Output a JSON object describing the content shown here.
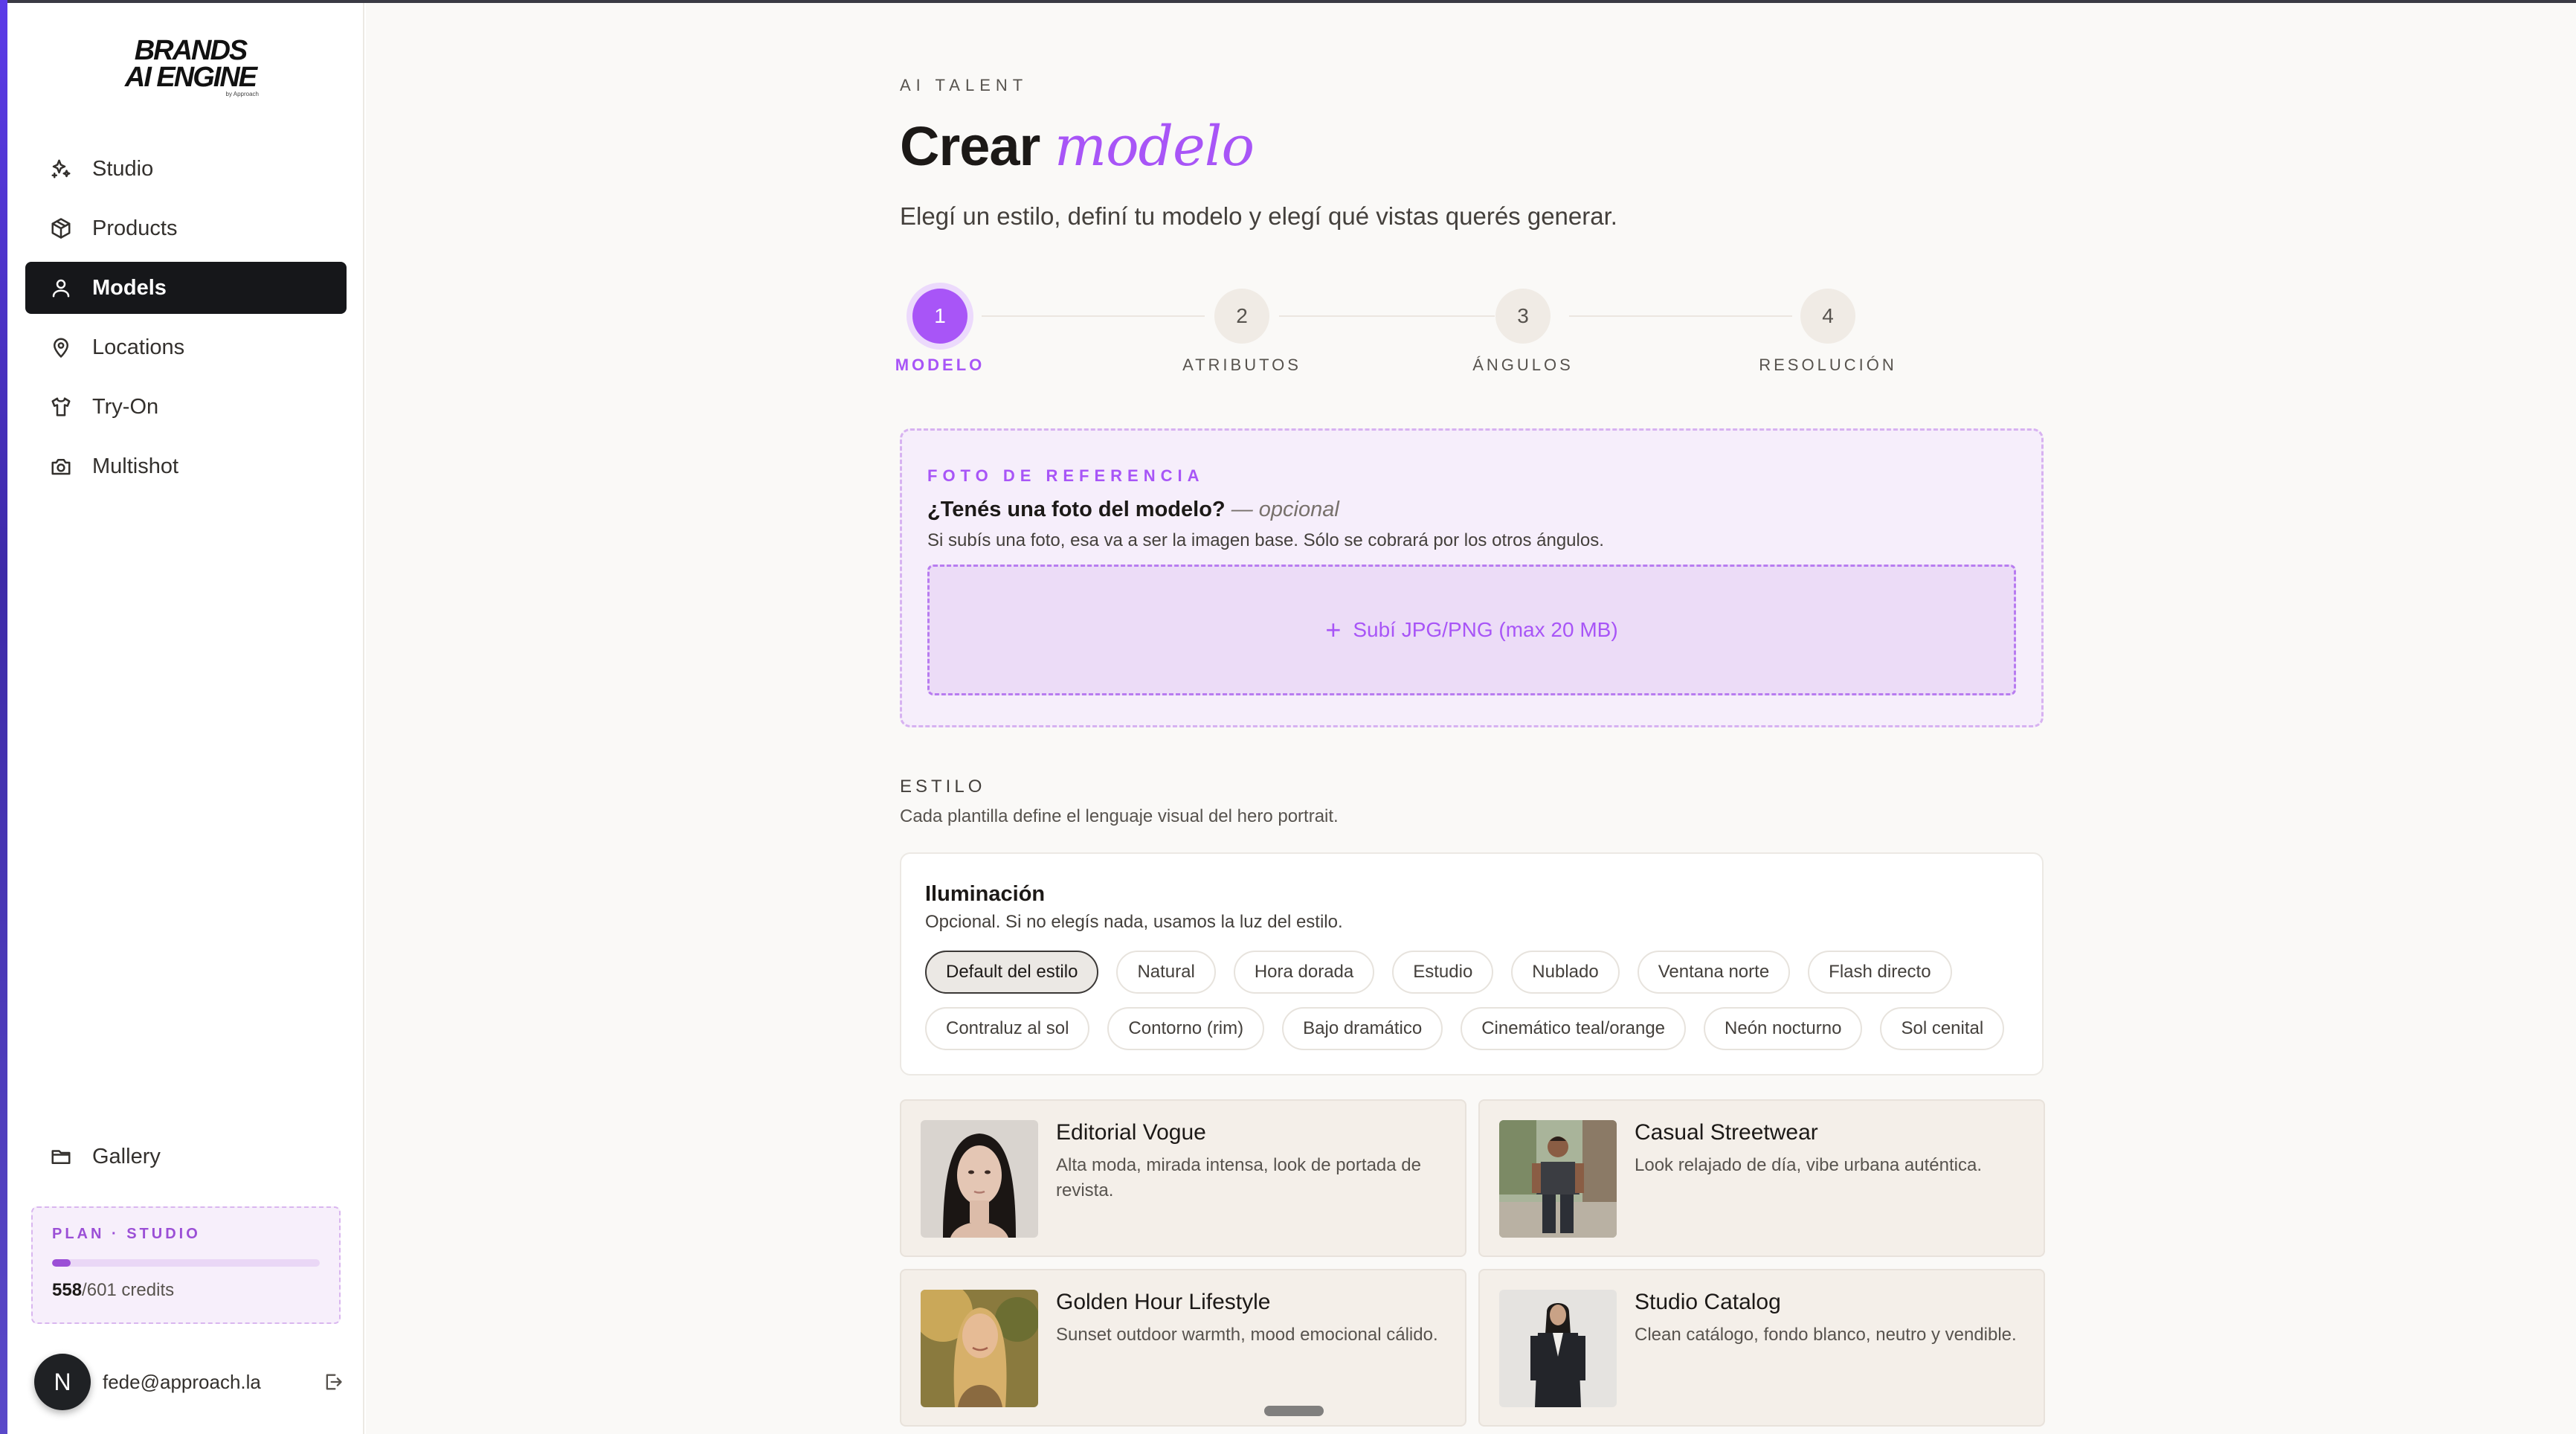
{
  "brand": {
    "line1": "BRANDS",
    "line2": "AI ENGINE",
    "line3": "by Approach"
  },
  "nav": [
    {
      "label": "Studio",
      "icon": "sparkles-icon"
    },
    {
      "label": "Products",
      "icon": "box-icon"
    },
    {
      "label": "Models",
      "icon": "user-icon",
      "active": true
    },
    {
      "label": "Locations",
      "icon": "map-pin-icon"
    },
    {
      "label": "Try-On",
      "icon": "shirt-icon"
    },
    {
      "label": "Multishot",
      "icon": "camera-icon"
    }
  ],
  "gallery": {
    "label": "Gallery",
    "icon": "folder-icon"
  },
  "plan": {
    "title": "PLAN · STUDIO",
    "used": "558",
    "total_credits": "/601 credits",
    "progress_fraction": 0.07
  },
  "user": {
    "initial": "N",
    "email": "fede@approach.la"
  },
  "header": {
    "eyebrow": "AI TALENT",
    "title_plain": "Crear",
    "title_italic": "modelo",
    "subtitle": "Elegí un estilo, definí tu modelo y elegí qué vistas querés generar."
  },
  "steps": [
    {
      "num": "1",
      "label": "MODELO",
      "active": true
    },
    {
      "num": "2",
      "label": "ATRIBUTOS"
    },
    {
      "num": "3",
      "label": "ÁNGULOS"
    },
    {
      "num": "4",
      "label": "RESOLUCIÓN"
    }
  ],
  "reference": {
    "eyebrow": "FOTO DE REFERENCIA",
    "question": "¿Tenés una foto del modelo?",
    "optional": " — opcional",
    "description": "Si subís una foto, esa va a ser la imagen base. Sólo se cobrará por los otros ángulos.",
    "upload_label": "Subí JPG/PNG (max 20 MB)"
  },
  "style": {
    "title": "ESTILO",
    "description": "Cada plantilla define el lenguaje visual del hero portrait."
  },
  "lighting": {
    "title": "Iluminación",
    "description": "Opcional. Si no elegís nada, usamos la luz del estilo.",
    "options": [
      "Default del estilo",
      "Natural",
      "Hora dorada",
      "Estudio",
      "Nublado",
      "Ventana norte",
      "Flash directo",
      "Contraluz al sol",
      "Contorno (rim)",
      "Bajo dramático",
      "Cinemático teal/orange",
      "Neón nocturno",
      "Sol cenital"
    ],
    "selected": "Default del estilo"
  },
  "templates": [
    {
      "title": "Editorial Vogue",
      "description": "Alta moda, mirada intensa, look de portada de revista."
    },
    {
      "title": "Casual Streetwear",
      "description": "Look relajado de día, vibe urbana auténtica."
    },
    {
      "title": "Golden Hour Lifestyle",
      "description": "Sunset outdoor warmth, mood emocional cálido."
    },
    {
      "title": "Studio Catalog",
      "description": "Clean catálogo, fondo blanco, neutro y vendible."
    }
  ],
  "colors": {
    "accent": "#a855f7",
    "nav_active_bg": "#16171a",
    "page_bg": "#faf9f7"
  }
}
